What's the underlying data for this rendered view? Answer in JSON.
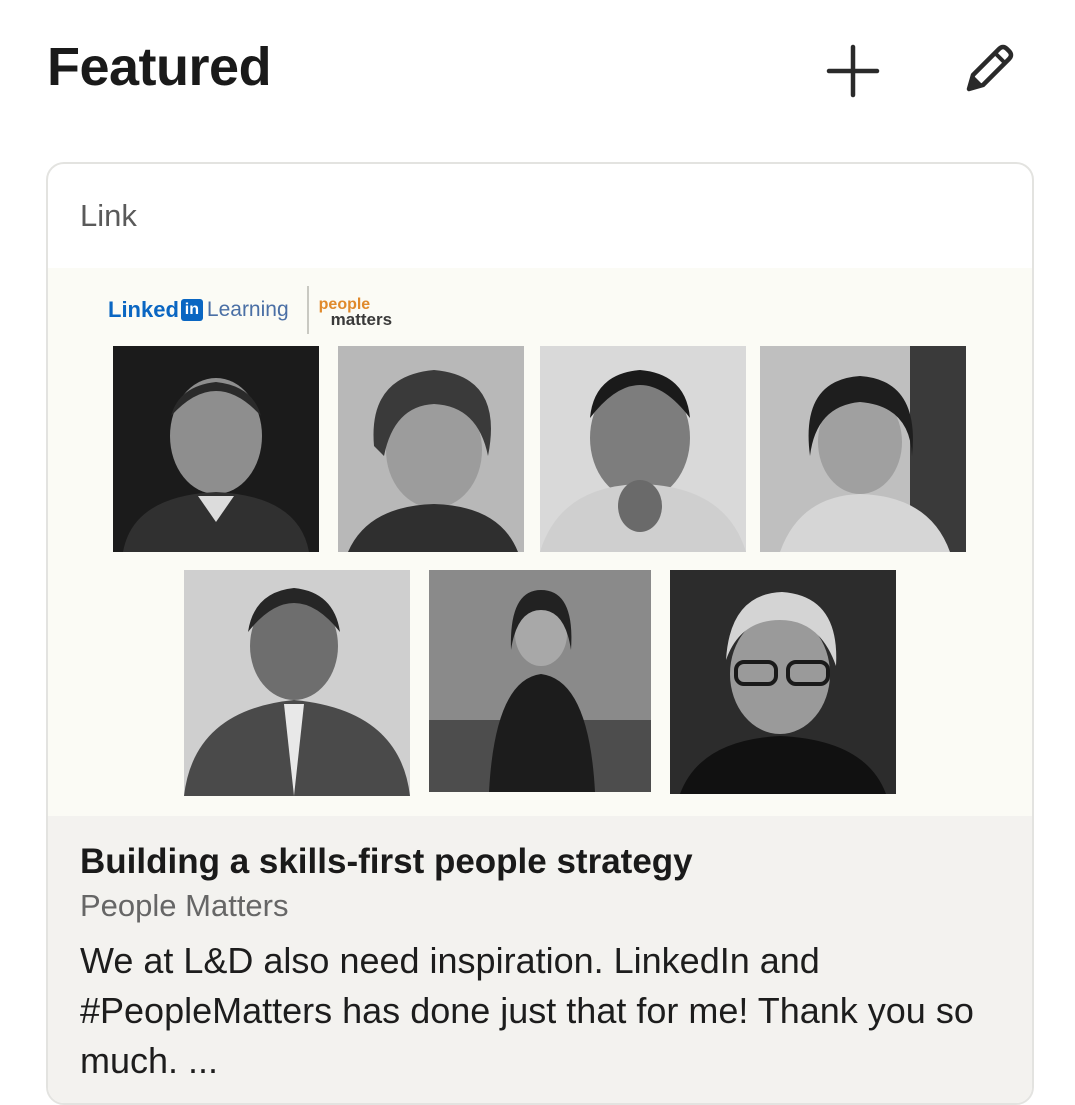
{
  "header": {
    "title": "Featured",
    "add_icon": "plus-icon",
    "edit_icon": "pencil-icon"
  },
  "card": {
    "type_label": "Link",
    "thumbnail": {
      "brand_linkedin": "Linked",
      "brand_in": "in",
      "brand_learning": "Learning",
      "brand_pm_top": "people",
      "brand_pm_bottom": "matters"
    },
    "title": "Building a skills-first people strategy",
    "source": "People Matters",
    "description": "We at L&D also need inspiration. LinkedIn and #PeopleMatters has done just that for me! Thank you so much. ..."
  },
  "colors": {
    "linkedin_blue": "#0a66c2",
    "body_bg": "#f3f2ef",
    "thumb_bg": "#fbfbf5",
    "pm_orange": "#e08a2c"
  }
}
